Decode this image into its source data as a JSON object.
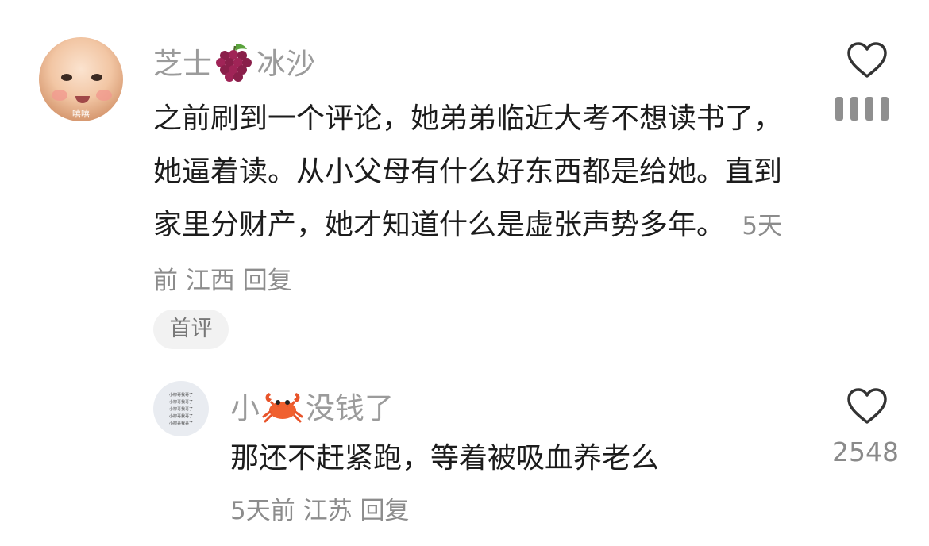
{
  "comment": {
    "username_parts": [
      "芝士",
      "冰沙"
    ],
    "username_emoji_icon": "grapes-icon",
    "text": "之前刷到一个评论，她弟弟临近大考不想读书了，她逼着读。从小父母有什么好东西都是给她。直到家里分财产，她才知道什么是虚张声势多年。",
    "time": "5天前",
    "location": "江西",
    "reply_label": "回复",
    "badge": "首评",
    "avatar_tag": "嘻嘻"
  },
  "reply": {
    "username_parts": [
      "小",
      "没钱了"
    ],
    "username_emoji_icon": "crab-icon",
    "text": "那还不赶紧跑，等着被吸血养老么",
    "time": "5天前",
    "location": "江苏",
    "reply_label": "回复",
    "like_count": "2548",
    "avatar_lines": [
      "小柳哥我哥了",
      "小柳哥我哥了",
      "小柳哥我哥了",
      "小柳哥我哥了",
      "小柳哥我哥了"
    ]
  },
  "colors": {
    "username": "#9b9b9b",
    "text": "#1c1c1c",
    "meta": "#8c8c8c",
    "badge_bg": "#f2f2f2"
  }
}
